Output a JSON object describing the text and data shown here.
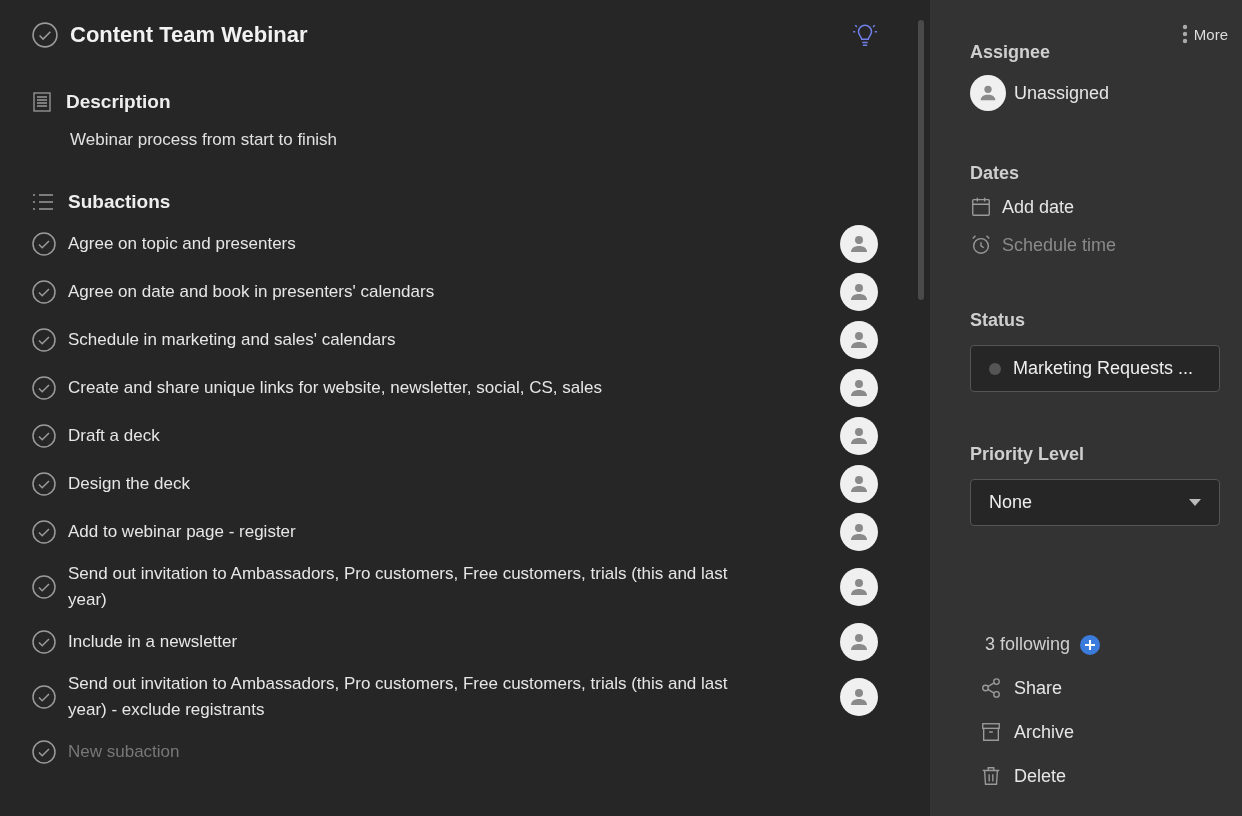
{
  "task": {
    "title": "Content Team Webinar"
  },
  "description": {
    "heading": "Description",
    "text": "Webinar process from start to finish"
  },
  "subactions": {
    "heading": "Subactions",
    "items": [
      {
        "text": "Agree on topic and presenters"
      },
      {
        "text": "Agree on date and book in presenters' calendars"
      },
      {
        "text": "Schedule in marketing and sales' calendars"
      },
      {
        "text": "Create and share unique links for website, newsletter, social, CS, sales"
      },
      {
        "text": "Draft a deck"
      },
      {
        "text": "Design the deck"
      },
      {
        "text": "Add to webinar page - register"
      },
      {
        "text": "Send out invitation to Ambassadors, Pro customers, Free customers, trials (this and last year)"
      },
      {
        "text": "Include in a newsletter"
      },
      {
        "text": "Send out invitation to Ambassadors, Pro customers, Free customers, trials (this and last year) - exclude registrants"
      }
    ],
    "new_placeholder": "New subaction"
  },
  "sidebar": {
    "more": "More",
    "assignee": {
      "heading": "Assignee",
      "value": "Unassigned"
    },
    "dates": {
      "heading": "Dates",
      "items": [
        {
          "label": "Add date",
          "kind": "date",
          "disabled": false
        },
        {
          "label": "Schedule time",
          "kind": "time",
          "disabled": true
        }
      ]
    },
    "status": {
      "heading": "Status",
      "value": "Marketing Requests ...",
      "color": "#555555"
    },
    "priority": {
      "heading": "Priority Level",
      "value": "None"
    },
    "following": "3 following",
    "actions": [
      {
        "label": "Share",
        "kind": "share"
      },
      {
        "label": "Archive",
        "kind": "archive"
      },
      {
        "label": "Delete",
        "kind": "delete"
      }
    ]
  }
}
